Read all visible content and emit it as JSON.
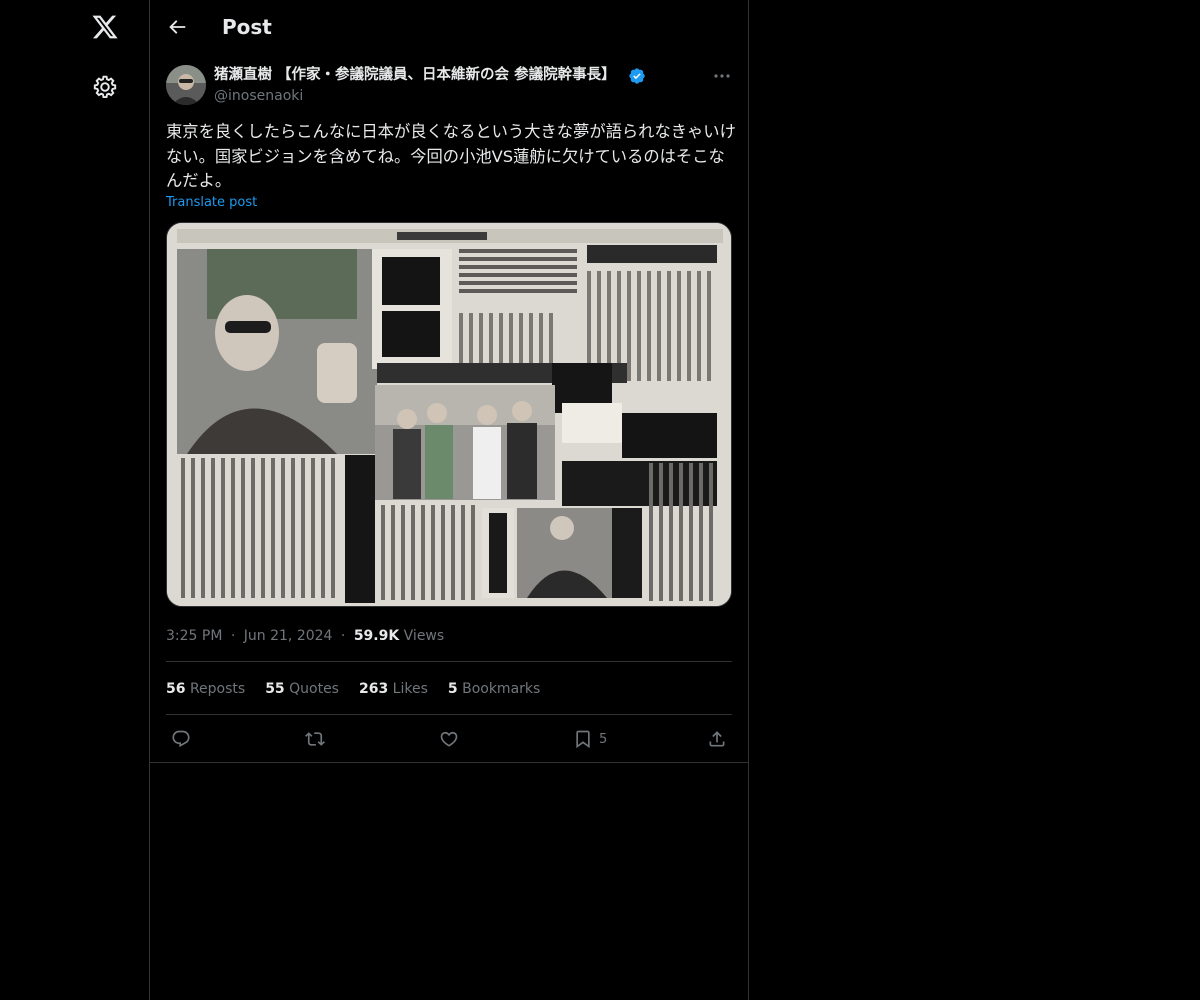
{
  "nav": {
    "logo_icon": "x-logo-icon",
    "settings_icon": "gear-icon"
  },
  "header": {
    "back_icon": "arrow-left-icon",
    "title": "Post"
  },
  "post": {
    "author": {
      "name": "猪瀬直樹 【作家・参議院議員、日本維新の会 参議院幹事長】",
      "handle": "@inosenaoki",
      "verified": true
    },
    "text": "東京を良くしたらこんなに日本が良くなるという大きな夢が語られなきゃいけない。国家ビジョンを含めてね。今回の小池VS蓮舫に欠けているのはそこなんだよ。",
    "translate_label": "Translate post",
    "media": {
      "description_icon": "newspaper-image"
    },
    "meta": {
      "time": "3:25 PM",
      "date": "Jun 21, 2024",
      "views_count": "59.9K",
      "views_label": "Views",
      "separator": "·"
    },
    "stats": {
      "reposts_count": "56",
      "reposts_label": "Reposts",
      "quotes_count": "55",
      "quotes_label": "Quotes",
      "likes_count": "263",
      "likes_label": "Likes",
      "bookmarks_count": "5",
      "bookmarks_label": "Bookmarks"
    },
    "actions": {
      "bookmark_count": "5"
    }
  },
  "colors": {
    "background": "#000000",
    "text": "#e7e9ea",
    "muted": "#71767b",
    "accent": "#1d9bf0",
    "border": "#2f3336"
  }
}
